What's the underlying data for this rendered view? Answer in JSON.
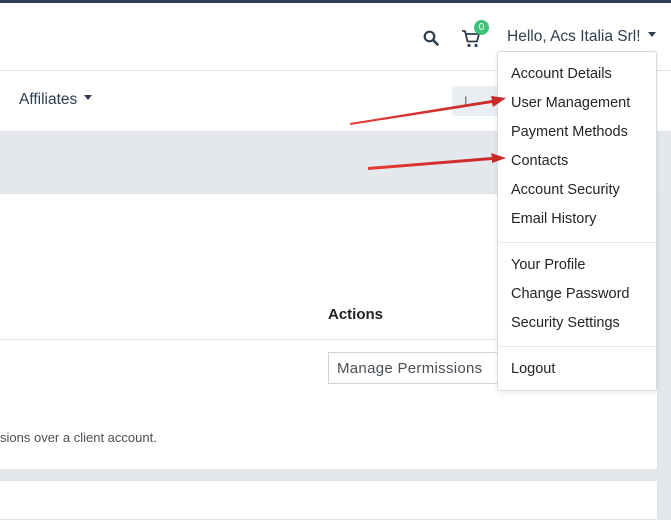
{
  "header": {
    "cart_count": "0",
    "greeting": "Hello, Acs Italia Srl!",
    "icons": [
      "search-icon",
      "cart-icon",
      "chevron-down-icon"
    ]
  },
  "nav": {
    "affiliates_label": "Affiliates"
  },
  "table": {
    "actions_header": "Actions",
    "manage_button_label": "Manage Permissions",
    "help_text": "sions over a client account."
  },
  "account_menu": {
    "items": [
      {
        "label": "Account Details"
      },
      {
        "label": "User Management"
      },
      {
        "label": "Payment Methods"
      },
      {
        "label": "Contacts"
      },
      {
        "label": "Account Security"
      },
      {
        "label": "Email History"
      },
      {
        "label": "Your Profile"
      },
      {
        "label": "Change Password"
      },
      {
        "label": "Security Settings"
      },
      {
        "label": "Logout"
      }
    ]
  },
  "colors": {
    "annotation_arrow": "#e53935",
    "badge": "#3dc27a",
    "nav_text": "#2c3e50"
  }
}
